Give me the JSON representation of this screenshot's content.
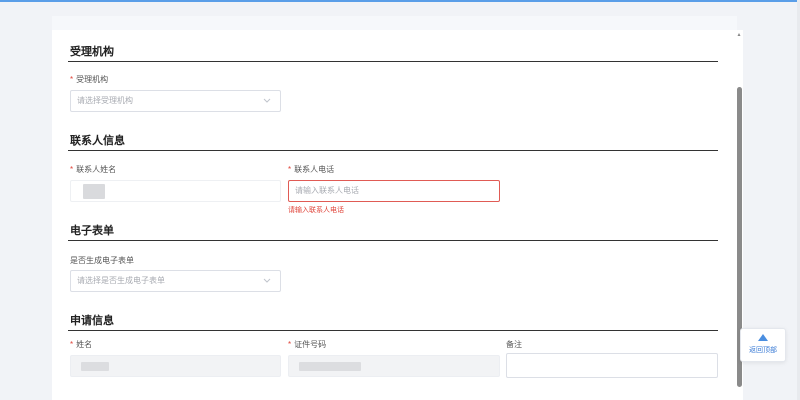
{
  "sections": {
    "agency": {
      "title": "受理机构",
      "agency_label": "受理机构",
      "agency_placeholder": "请选择受理机构"
    },
    "contact": {
      "title": "联系人信息",
      "name_label": "联系人姓名",
      "phone_label": "联系人电话",
      "phone_placeholder": "请输入联系人电话",
      "phone_error": "请输入联系人电话"
    },
    "eform": {
      "title": "电子表单",
      "generated_label": "是否生成电子表单",
      "generated_placeholder": "请选择是否生成电子表单"
    },
    "application": {
      "title": "申请信息",
      "name_label": "姓名",
      "id_label": "证件号码",
      "remark_label": "备注"
    }
  },
  "required_mark": "*",
  "back_to_top": {
    "label": "返回顶部"
  },
  "colors": {
    "accent": "#4a8ee0",
    "error": "#e0443a",
    "divider": "#333333"
  },
  "icons": {
    "select_chevron": "chevron-down-icon",
    "back_top": "arrow-up-icon"
  }
}
